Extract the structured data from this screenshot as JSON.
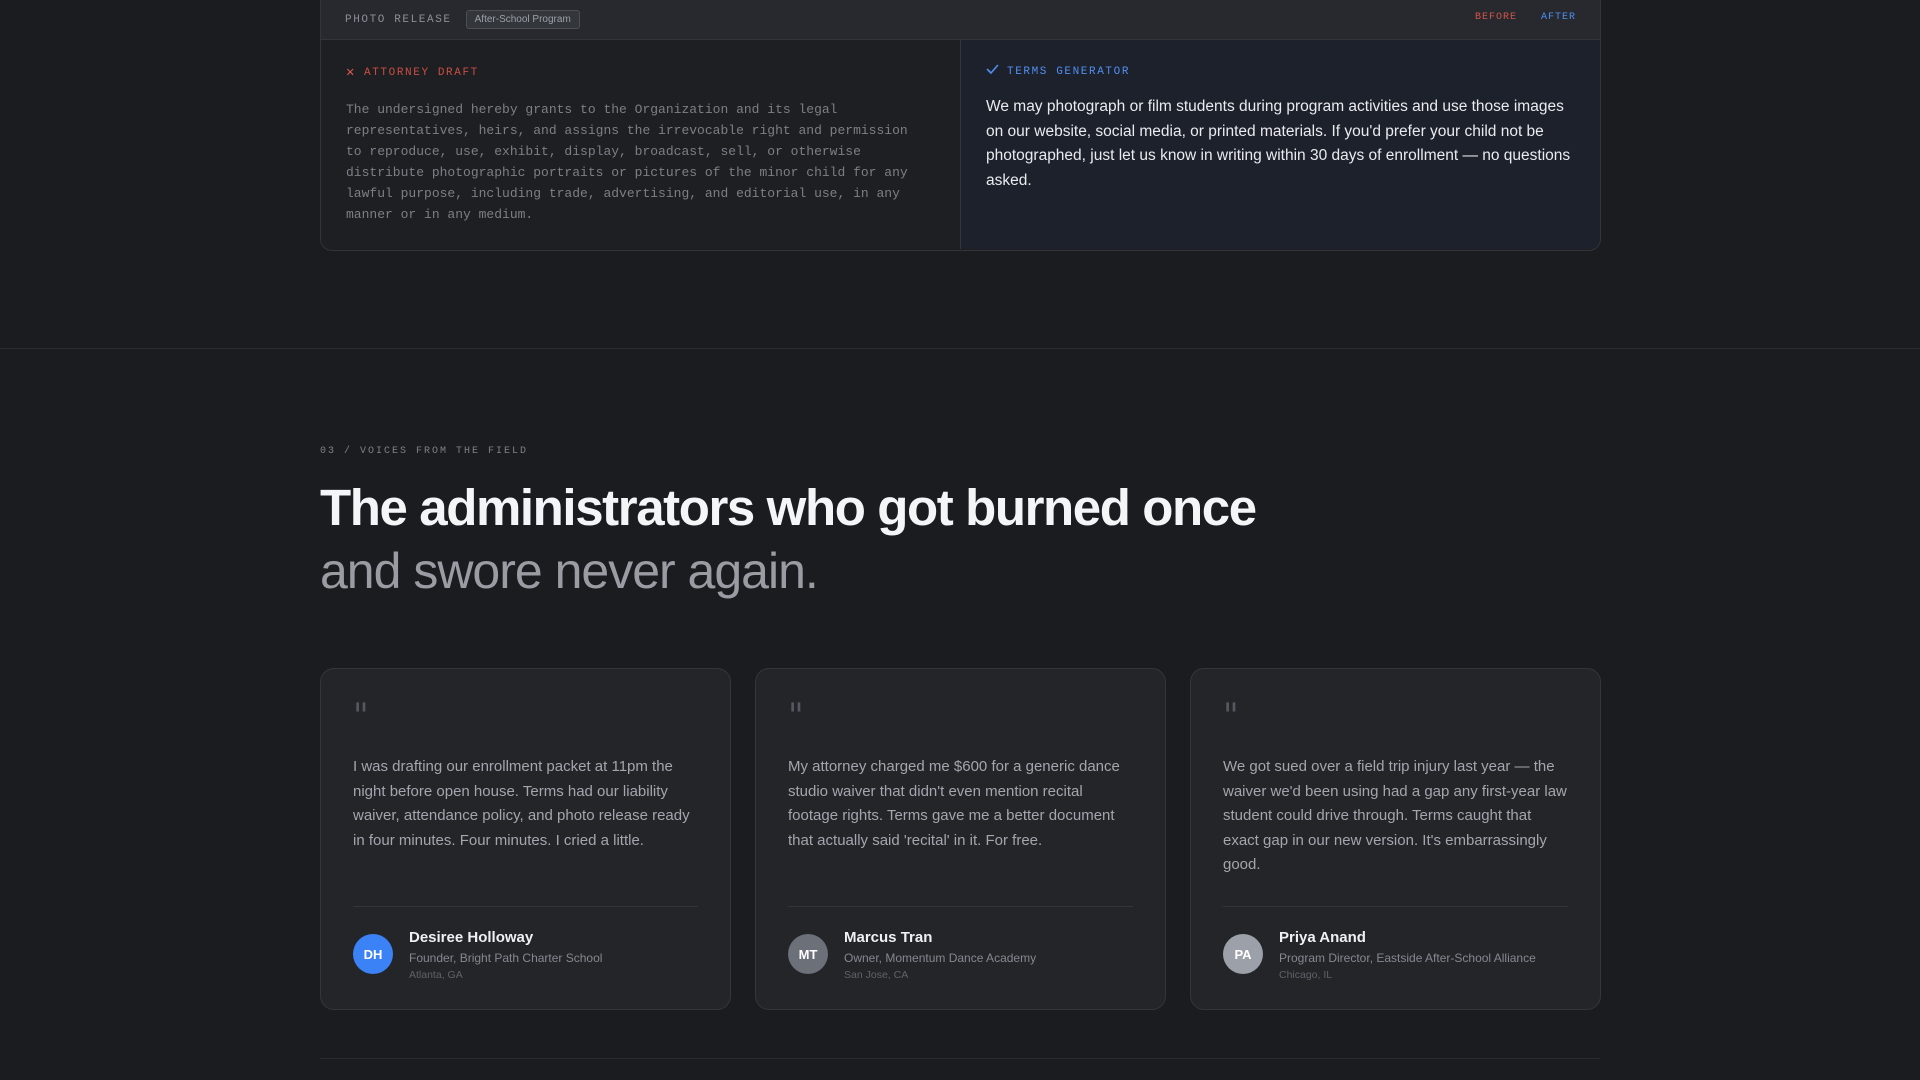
{
  "comparison": {
    "doc_label": "PHOTO RELEASE",
    "tag": "After-School Program",
    "toggle_before": "BEFORE",
    "toggle_after": "AFTER",
    "before": {
      "heading": "ATTORNEY DRAFT",
      "icon": "x-icon",
      "text": "The undersigned hereby grants to the Organization and its legal representatives, heirs, and assigns the irrevocable right and permission to reproduce, use, exhibit, display, broadcast, sell, or otherwise distribute photographic portraits or pictures of the minor child for any lawful purpose, including trade, advertising, and editorial use, in any manner or in any medium."
    },
    "after": {
      "heading": "TERMS GENERATOR",
      "icon": "check-icon",
      "text": "We may photograph or film students during program activities and use those images on our website, social media, or printed materials. If you'd prefer your child not be photographed, just let us know in writing within 30 days of enrollment — no questions asked."
    }
  },
  "section": {
    "eyebrow": "03 / VOICES FROM THE FIELD",
    "headline": "The administrators who got burned once",
    "subheadline": "and swore never again."
  },
  "testimonials": [
    {
      "quote_mark": "\"",
      "quote": "I was drafting our enrollment packet at 11pm the night before open house. Terms had our liability waiver, attendance policy, and photo release ready in four minutes. Four minutes. I cried a little.",
      "initials": "DH",
      "name": "Desiree Holloway",
      "role": "Founder, Bright Path Charter School",
      "location": "Atlanta, GA",
      "avatar_color": "#3b82f6"
    },
    {
      "quote_mark": "\"",
      "quote": "My attorney charged me $600 for a generic dance studio waiver that didn't even mention recital footage rights. Terms gave me a better document that actually said 'recital' in it. For free.",
      "initials": "MT",
      "name": "Marcus Tran",
      "role": "Owner, Momentum Dance Academy",
      "location": "San Jose, CA",
      "avatar_color": "#6b7079"
    },
    {
      "quote_mark": "\"",
      "quote": "We got sued over a field trip injury last year — the waiver we'd been using had a gap any first-year law student could drive through. Terms caught that exact gap in our new version. It's embarrassingly good.",
      "initials": "PA",
      "name": "Priya Anand",
      "role": "Program Director, Eastside After-School Alliance",
      "location": "Chicago, IL",
      "avatar_color": "#9ca0a8"
    }
  ],
  "colors": {
    "background": "#1b1c1f",
    "before_accent": "#d5554a",
    "after_accent": "#4f8ff2"
  }
}
